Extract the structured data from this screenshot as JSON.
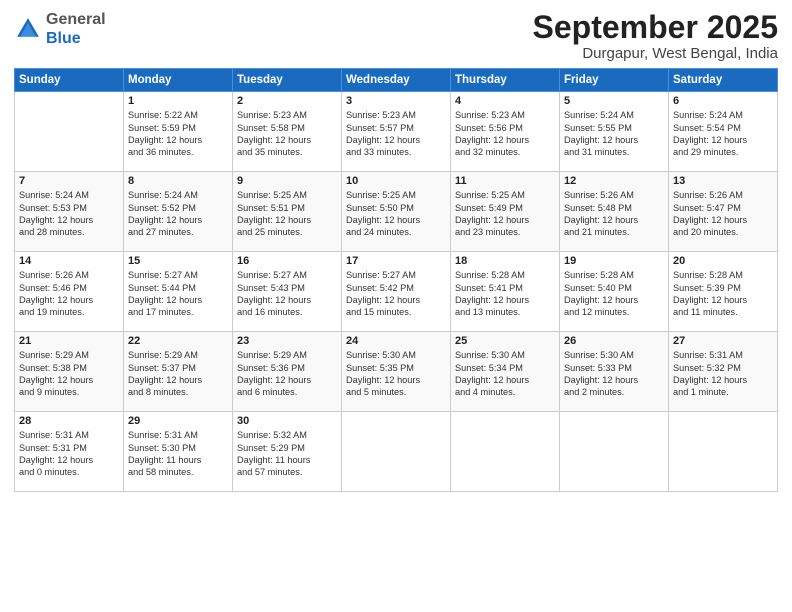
{
  "header": {
    "logo_general": "General",
    "logo_blue": "Blue",
    "month_title": "September 2025",
    "location": "Durgapur, West Bengal, India"
  },
  "days_of_week": [
    "Sunday",
    "Monday",
    "Tuesday",
    "Wednesday",
    "Thursday",
    "Friday",
    "Saturday"
  ],
  "weeks": [
    [
      {
        "day": "",
        "text": ""
      },
      {
        "day": "1",
        "text": "Sunrise: 5:22 AM\nSunset: 5:59 PM\nDaylight: 12 hours\nand 36 minutes."
      },
      {
        "day": "2",
        "text": "Sunrise: 5:23 AM\nSunset: 5:58 PM\nDaylight: 12 hours\nand 35 minutes."
      },
      {
        "day": "3",
        "text": "Sunrise: 5:23 AM\nSunset: 5:57 PM\nDaylight: 12 hours\nand 33 minutes."
      },
      {
        "day": "4",
        "text": "Sunrise: 5:23 AM\nSunset: 5:56 PM\nDaylight: 12 hours\nand 32 minutes."
      },
      {
        "day": "5",
        "text": "Sunrise: 5:24 AM\nSunset: 5:55 PM\nDaylight: 12 hours\nand 31 minutes."
      },
      {
        "day": "6",
        "text": "Sunrise: 5:24 AM\nSunset: 5:54 PM\nDaylight: 12 hours\nand 29 minutes."
      }
    ],
    [
      {
        "day": "7",
        "text": "Sunrise: 5:24 AM\nSunset: 5:53 PM\nDaylight: 12 hours\nand 28 minutes."
      },
      {
        "day": "8",
        "text": "Sunrise: 5:24 AM\nSunset: 5:52 PM\nDaylight: 12 hours\nand 27 minutes."
      },
      {
        "day": "9",
        "text": "Sunrise: 5:25 AM\nSunset: 5:51 PM\nDaylight: 12 hours\nand 25 minutes."
      },
      {
        "day": "10",
        "text": "Sunrise: 5:25 AM\nSunset: 5:50 PM\nDaylight: 12 hours\nand 24 minutes."
      },
      {
        "day": "11",
        "text": "Sunrise: 5:25 AM\nSunset: 5:49 PM\nDaylight: 12 hours\nand 23 minutes."
      },
      {
        "day": "12",
        "text": "Sunrise: 5:26 AM\nSunset: 5:48 PM\nDaylight: 12 hours\nand 21 minutes."
      },
      {
        "day": "13",
        "text": "Sunrise: 5:26 AM\nSunset: 5:47 PM\nDaylight: 12 hours\nand 20 minutes."
      }
    ],
    [
      {
        "day": "14",
        "text": "Sunrise: 5:26 AM\nSunset: 5:46 PM\nDaylight: 12 hours\nand 19 minutes."
      },
      {
        "day": "15",
        "text": "Sunrise: 5:27 AM\nSunset: 5:44 PM\nDaylight: 12 hours\nand 17 minutes."
      },
      {
        "day": "16",
        "text": "Sunrise: 5:27 AM\nSunset: 5:43 PM\nDaylight: 12 hours\nand 16 minutes."
      },
      {
        "day": "17",
        "text": "Sunrise: 5:27 AM\nSunset: 5:42 PM\nDaylight: 12 hours\nand 15 minutes."
      },
      {
        "day": "18",
        "text": "Sunrise: 5:28 AM\nSunset: 5:41 PM\nDaylight: 12 hours\nand 13 minutes."
      },
      {
        "day": "19",
        "text": "Sunrise: 5:28 AM\nSunset: 5:40 PM\nDaylight: 12 hours\nand 12 minutes."
      },
      {
        "day": "20",
        "text": "Sunrise: 5:28 AM\nSunset: 5:39 PM\nDaylight: 12 hours\nand 11 minutes."
      }
    ],
    [
      {
        "day": "21",
        "text": "Sunrise: 5:29 AM\nSunset: 5:38 PM\nDaylight: 12 hours\nand 9 minutes."
      },
      {
        "day": "22",
        "text": "Sunrise: 5:29 AM\nSunset: 5:37 PM\nDaylight: 12 hours\nand 8 minutes."
      },
      {
        "day": "23",
        "text": "Sunrise: 5:29 AM\nSunset: 5:36 PM\nDaylight: 12 hours\nand 6 minutes."
      },
      {
        "day": "24",
        "text": "Sunrise: 5:30 AM\nSunset: 5:35 PM\nDaylight: 12 hours\nand 5 minutes."
      },
      {
        "day": "25",
        "text": "Sunrise: 5:30 AM\nSunset: 5:34 PM\nDaylight: 12 hours\nand 4 minutes."
      },
      {
        "day": "26",
        "text": "Sunrise: 5:30 AM\nSunset: 5:33 PM\nDaylight: 12 hours\nand 2 minutes."
      },
      {
        "day": "27",
        "text": "Sunrise: 5:31 AM\nSunset: 5:32 PM\nDaylight: 12 hours\nand 1 minute."
      }
    ],
    [
      {
        "day": "28",
        "text": "Sunrise: 5:31 AM\nSunset: 5:31 PM\nDaylight: 12 hours\nand 0 minutes."
      },
      {
        "day": "29",
        "text": "Sunrise: 5:31 AM\nSunset: 5:30 PM\nDaylight: 11 hours\nand 58 minutes."
      },
      {
        "day": "30",
        "text": "Sunrise: 5:32 AM\nSunset: 5:29 PM\nDaylight: 11 hours\nand 57 minutes."
      },
      {
        "day": "",
        "text": ""
      },
      {
        "day": "",
        "text": ""
      },
      {
        "day": "",
        "text": ""
      },
      {
        "day": "",
        "text": ""
      }
    ]
  ]
}
